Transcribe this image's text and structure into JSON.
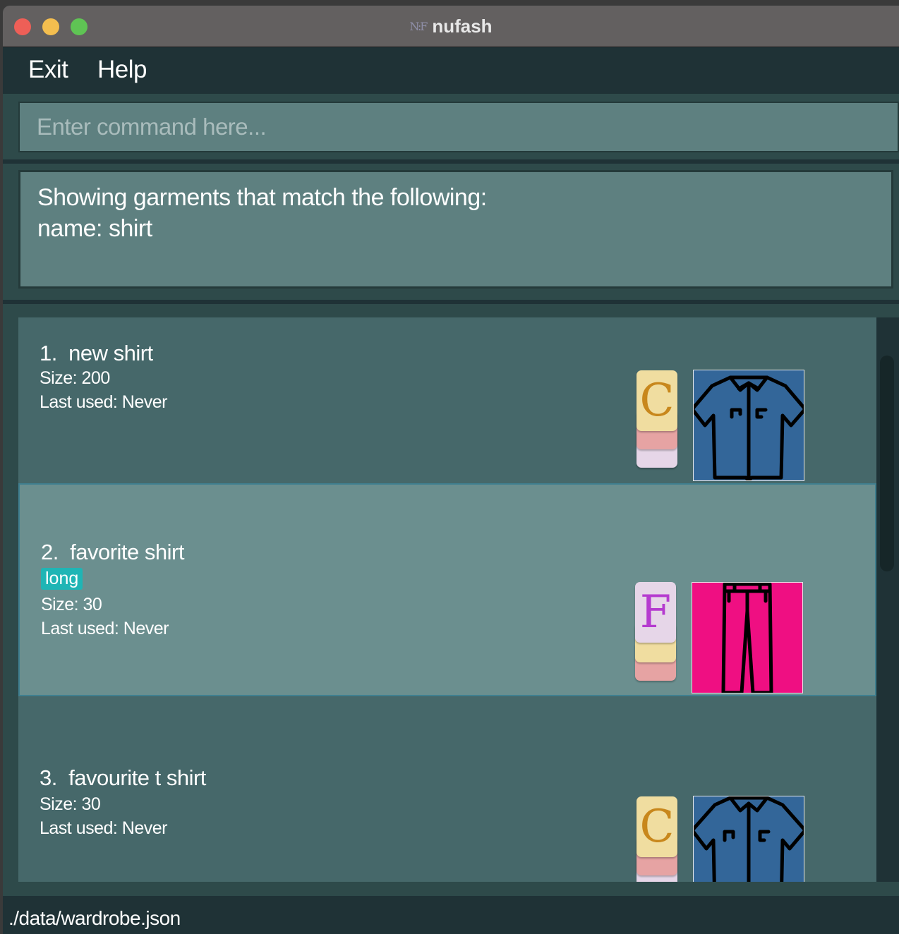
{
  "window": {
    "title": "nufash",
    "app_icon": "N:F",
    "traffic_lights": [
      "close",
      "minimize",
      "zoom"
    ]
  },
  "menu": {
    "items": [
      {
        "label": "Exit"
      },
      {
        "label": "Help"
      }
    ]
  },
  "command": {
    "placeholder": "Enter command here...",
    "value": ""
  },
  "result": {
    "line1": "Showing garments that match the following:",
    "line2": "name: shirt"
  },
  "garments": [
    {
      "index": "1.",
      "name": "new shirt",
      "tags": [],
      "size": "Size: 200",
      "last_used": "Last used: Never",
      "dress_code_letter": "C",
      "letter_color": "#c8871c",
      "image": "shirt-icon",
      "image_bg": "#336699"
    },
    {
      "index": "2.",
      "name": "favorite shirt",
      "tags": [
        "long"
      ],
      "size": "Size: 30",
      "last_used": "Last used: Never",
      "dress_code_letter": "F",
      "letter_color": "#b53bcf",
      "image": "pants-icon",
      "image_bg": "#ef0f82"
    },
    {
      "index": "3.",
      "name": "favourite t shirt",
      "tags": [],
      "size": "Size: 30",
      "last_used": "Last used: Never",
      "dress_code_letter": "C",
      "letter_color": "#c8871c",
      "image": "shirt-icon",
      "image_bg": "#336699"
    }
  ],
  "colors": {
    "badge_yellow": "#f0dda0",
    "badge_pink": "#e6a3a3",
    "badge_lavender": "#e6d6e8"
  },
  "status": {
    "path": "./data/wardrobe.json"
  }
}
